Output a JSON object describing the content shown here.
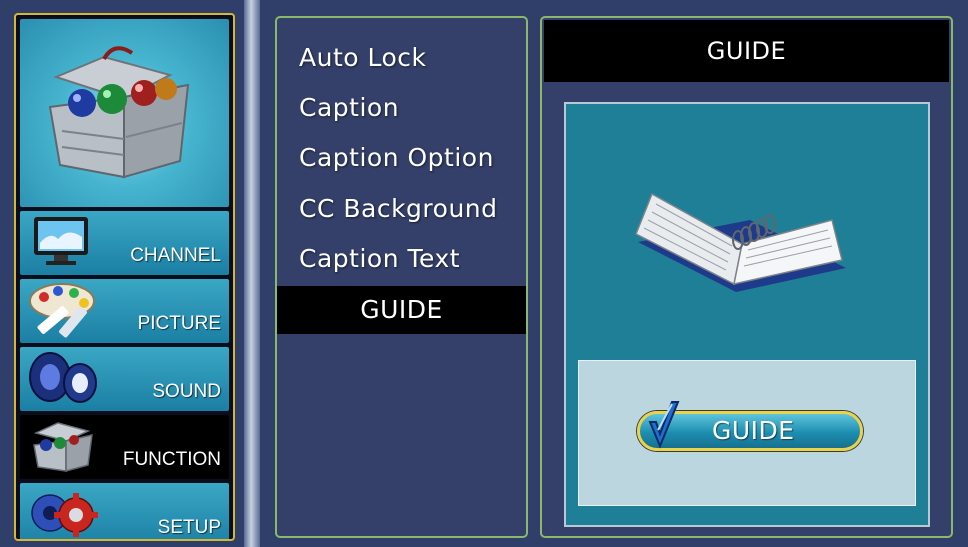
{
  "sidebar": {
    "items": [
      {
        "label": "CHANNEL",
        "icon": "tv-icon",
        "active": false
      },
      {
        "label": "PICTURE",
        "icon": "palette-icon",
        "active": false
      },
      {
        "label": "SOUND",
        "icon": "speaker-icon",
        "active": false
      },
      {
        "label": "FUNCTION",
        "icon": "toolbox-icon",
        "active": true
      },
      {
        "label": "SETUP",
        "icon": "gears-icon",
        "active": false
      }
    ],
    "hero_icon": "toolbox-icon"
  },
  "menu": {
    "items": [
      "Auto Lock",
      "Caption",
      "Caption Option",
      "CC Background",
      "Caption Text",
      "GUIDE"
    ],
    "selected": "GUIDE"
  },
  "detail": {
    "title": "GUIDE",
    "image_icon": "book-icon",
    "button_label": "GUIDE",
    "button_icon": "checkmark-icon"
  },
  "colors": {
    "background": "#2f3f6a",
    "panel_border": "#8ab86c",
    "sidebar_border": "#d6b830",
    "selected_bg": "#000000",
    "detail_bg": "#1f7f96",
    "button_border": "#e8d34a"
  }
}
